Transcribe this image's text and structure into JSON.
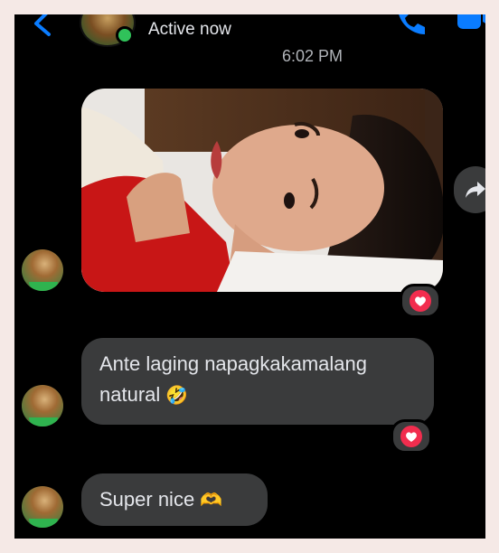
{
  "header": {
    "status": "Active now",
    "icons": {
      "back": "chevron-left-icon",
      "phone": "phone-icon",
      "video": "video-camera-icon"
    },
    "accent_color": "#0a7cff"
  },
  "conversation": {
    "timestamp": "6:02 PM",
    "messages": [
      {
        "type": "photo",
        "reaction": "heart"
      },
      {
        "type": "text",
        "text": "Ante laging napagkakamalang natural",
        "emoji": "🤣",
        "reaction": "heart"
      },
      {
        "type": "text",
        "text": "Super nice",
        "emoji": "🫶"
      }
    ]
  }
}
